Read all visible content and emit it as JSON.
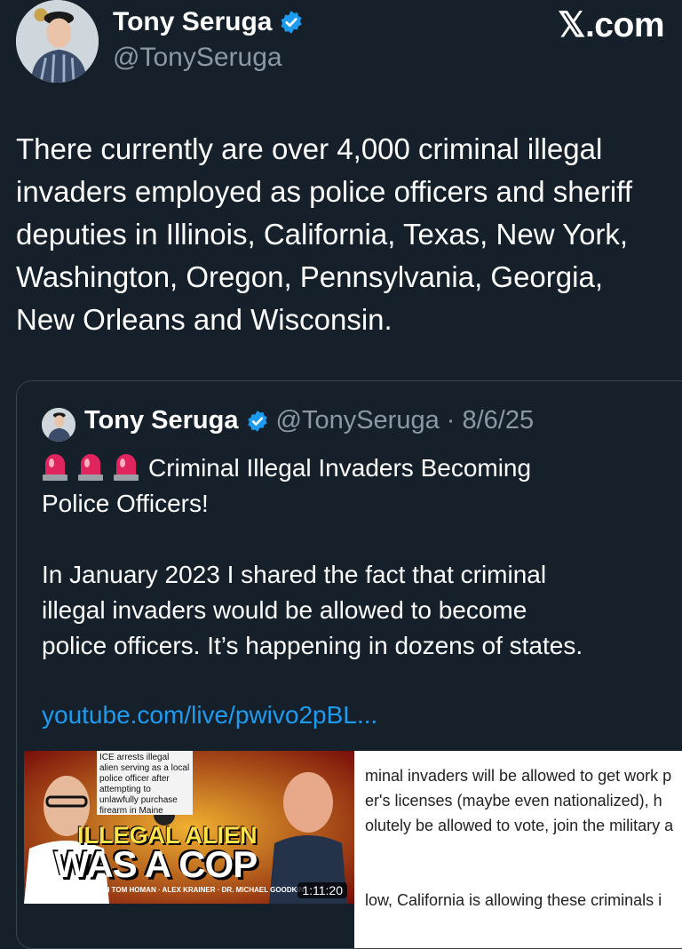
{
  "author": {
    "name": "Tony Seruga",
    "handle": "@TonySeruga"
  },
  "brand": "𝕏.com",
  "tweet": {
    "lines": [
      "There currently are over 4,000 criminal illegal",
      "invaders employed as police officers and sheriff",
      "deputies in Illinois, California, Texas, New York,",
      "Washington, Oregon, Pennsylvania, Georgia,",
      "New Orleans and Wisconsin."
    ]
  },
  "quote": {
    "name": "Tony Seruga",
    "meta": "@TonySeruga · 8/6/25",
    "headline_1": "Criminal Illegal Invaders Becoming",
    "headline_2": "Police Officers!",
    "body": [
      "In January 2023 I shared the fact that criminal",
      "illegal invaders would be allowed to become",
      "police officers. It’s happening in dozens of states."
    ],
    "link": "youtube.com/live/pwivo2pBL...",
    "video": {
      "overlay_text": "ICE arrests illegal alien serving as a local police officer after attempting to unlawfully purchase firearm in Maine",
      "title_1": "ILLEGAL ALIEN",
      "title_2": "WAS A COP",
      "credits": "WITH TOM HOMAN · ALEX KRAINER · DR. MICHAEL GOODKIN",
      "duration": "1:11:20"
    },
    "article_lines": [
      "minal invaders will be allowed to get work p",
      "er's licenses (maybe even nationalized), h",
      "olutely be allowed to vote, join the military a",
      "low, California is allowing these criminals i"
    ]
  },
  "colors": {
    "background": "#15202b",
    "link": "#1d9bf0",
    "verified": "#1d9bf0",
    "muted": "#8b98a5"
  }
}
